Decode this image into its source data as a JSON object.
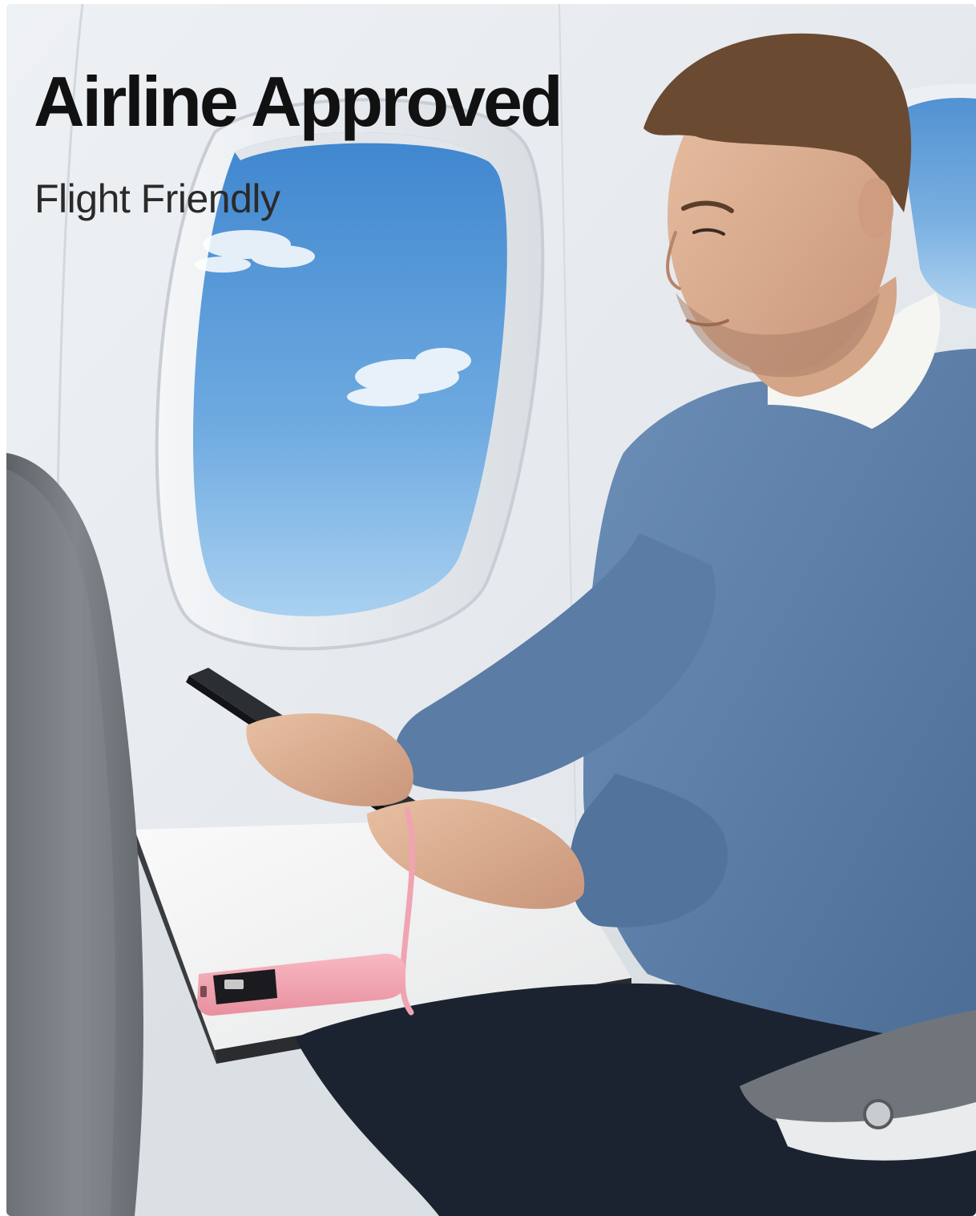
{
  "headline": "Airline Approved",
  "subheadline": "Flight Friendly",
  "colors": {
    "cabin_wall": "#e6eaee",
    "sky": "#5b9bd8",
    "sweater": "#5b7ea8",
    "power_bank": "#f2a2b0",
    "seat": "#6e7378",
    "headline_text": "#111111"
  },
  "scene_elements": [
    "airplane-window",
    "passenger",
    "tablet",
    "power-bank",
    "tray-table",
    "front-seat",
    "armrest"
  ]
}
